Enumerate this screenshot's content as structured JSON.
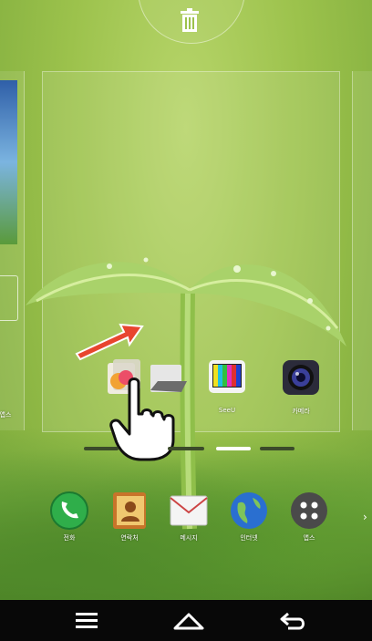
{
  "screen": {
    "description_free": true
  },
  "top": {
    "trash_icon": "trash-icon"
  },
  "panel": {
    "apps": [
      {
        "icon": "folder-icon",
        "label": ""
      },
      {
        "icon": "tv-icon",
        "label": "SeeU"
      },
      {
        "icon": "camera-icon",
        "label": "카메라"
      }
    ],
    "left_label": "앱스"
  },
  "indicators": {
    "count": 4,
    "active_index": 2
  },
  "dock": {
    "items": [
      {
        "icon": "phone-icon",
        "label": "전화"
      },
      {
        "icon": "contacts-icon",
        "label": "연락처"
      },
      {
        "icon": "messages-icon",
        "label": "메시지"
      },
      {
        "icon": "internet-icon",
        "label": "인터넷"
      },
      {
        "icon": "apps-icon",
        "label": "앱스"
      }
    ]
  },
  "navbar": {
    "menu_icon": "menu-icon",
    "home_icon": "home-icon",
    "back_icon": "back-icon"
  },
  "colors": {
    "drag_arrow": "#e8452e",
    "navbar": "#080808",
    "indicator_active": "#ffffff",
    "indicator_inactive": "#3b4a2a"
  }
}
